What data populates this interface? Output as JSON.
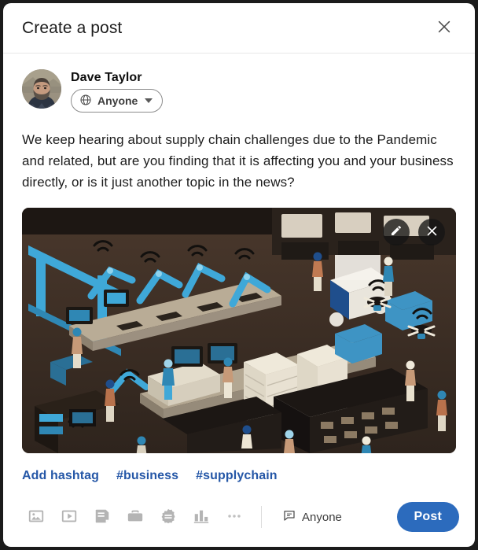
{
  "dialog": {
    "title": "Create a post",
    "close_icon": "close-icon"
  },
  "author": {
    "name": "Dave Taylor",
    "avatar_alt": "avatar",
    "audience": {
      "label": "Anyone",
      "icon": "globe-icon",
      "chevron": "chevron-down-icon"
    }
  },
  "post": {
    "text": "We keep hearing about supply chain challenges due to the Pandemic and related, but are you finding that it is affecting you and your business directly, or is it just another topic in the news?"
  },
  "media": {
    "alt": "Isometric illustration of an automated warehouse and supply chain with robotic arms, conveyor belts, drones, forklifts, servers and workers",
    "edit_label": "edit-media",
    "edit_icon": "pencil-icon",
    "remove_label": "remove-media",
    "remove_icon": "close-icon"
  },
  "hashtags": [
    {
      "label": "Add hashtag"
    },
    {
      "label": "#business"
    },
    {
      "label": "#supplychain"
    }
  ],
  "toolbar": {
    "items": [
      {
        "name": "add-photo-button",
        "icon": "image-icon",
        "title": "Add a photo"
      },
      {
        "name": "add-video-button",
        "icon": "video-icon",
        "title": "Add a video"
      },
      {
        "name": "add-document-button",
        "icon": "document-icon",
        "title": "Add a document"
      },
      {
        "name": "create-job-button",
        "icon": "briefcase-icon",
        "title": "Create a job"
      },
      {
        "name": "celebrate-button",
        "icon": "award-icon",
        "title": "Celebrate an occasion"
      },
      {
        "name": "create-poll-button",
        "icon": "poll-icon",
        "title": "Create a poll"
      },
      {
        "name": "more-options-button",
        "icon": "ellipsis-icon",
        "title": "More"
      }
    ],
    "comment_control": {
      "label": "Anyone",
      "icon": "comment-icon"
    },
    "post_label": "Post"
  },
  "colors": {
    "accent": "#2c6bbd",
    "link": "#2557a7",
    "text": "#1c1c1c",
    "icon_gray": "#b4b4b4",
    "border": "#e8e8e8"
  }
}
